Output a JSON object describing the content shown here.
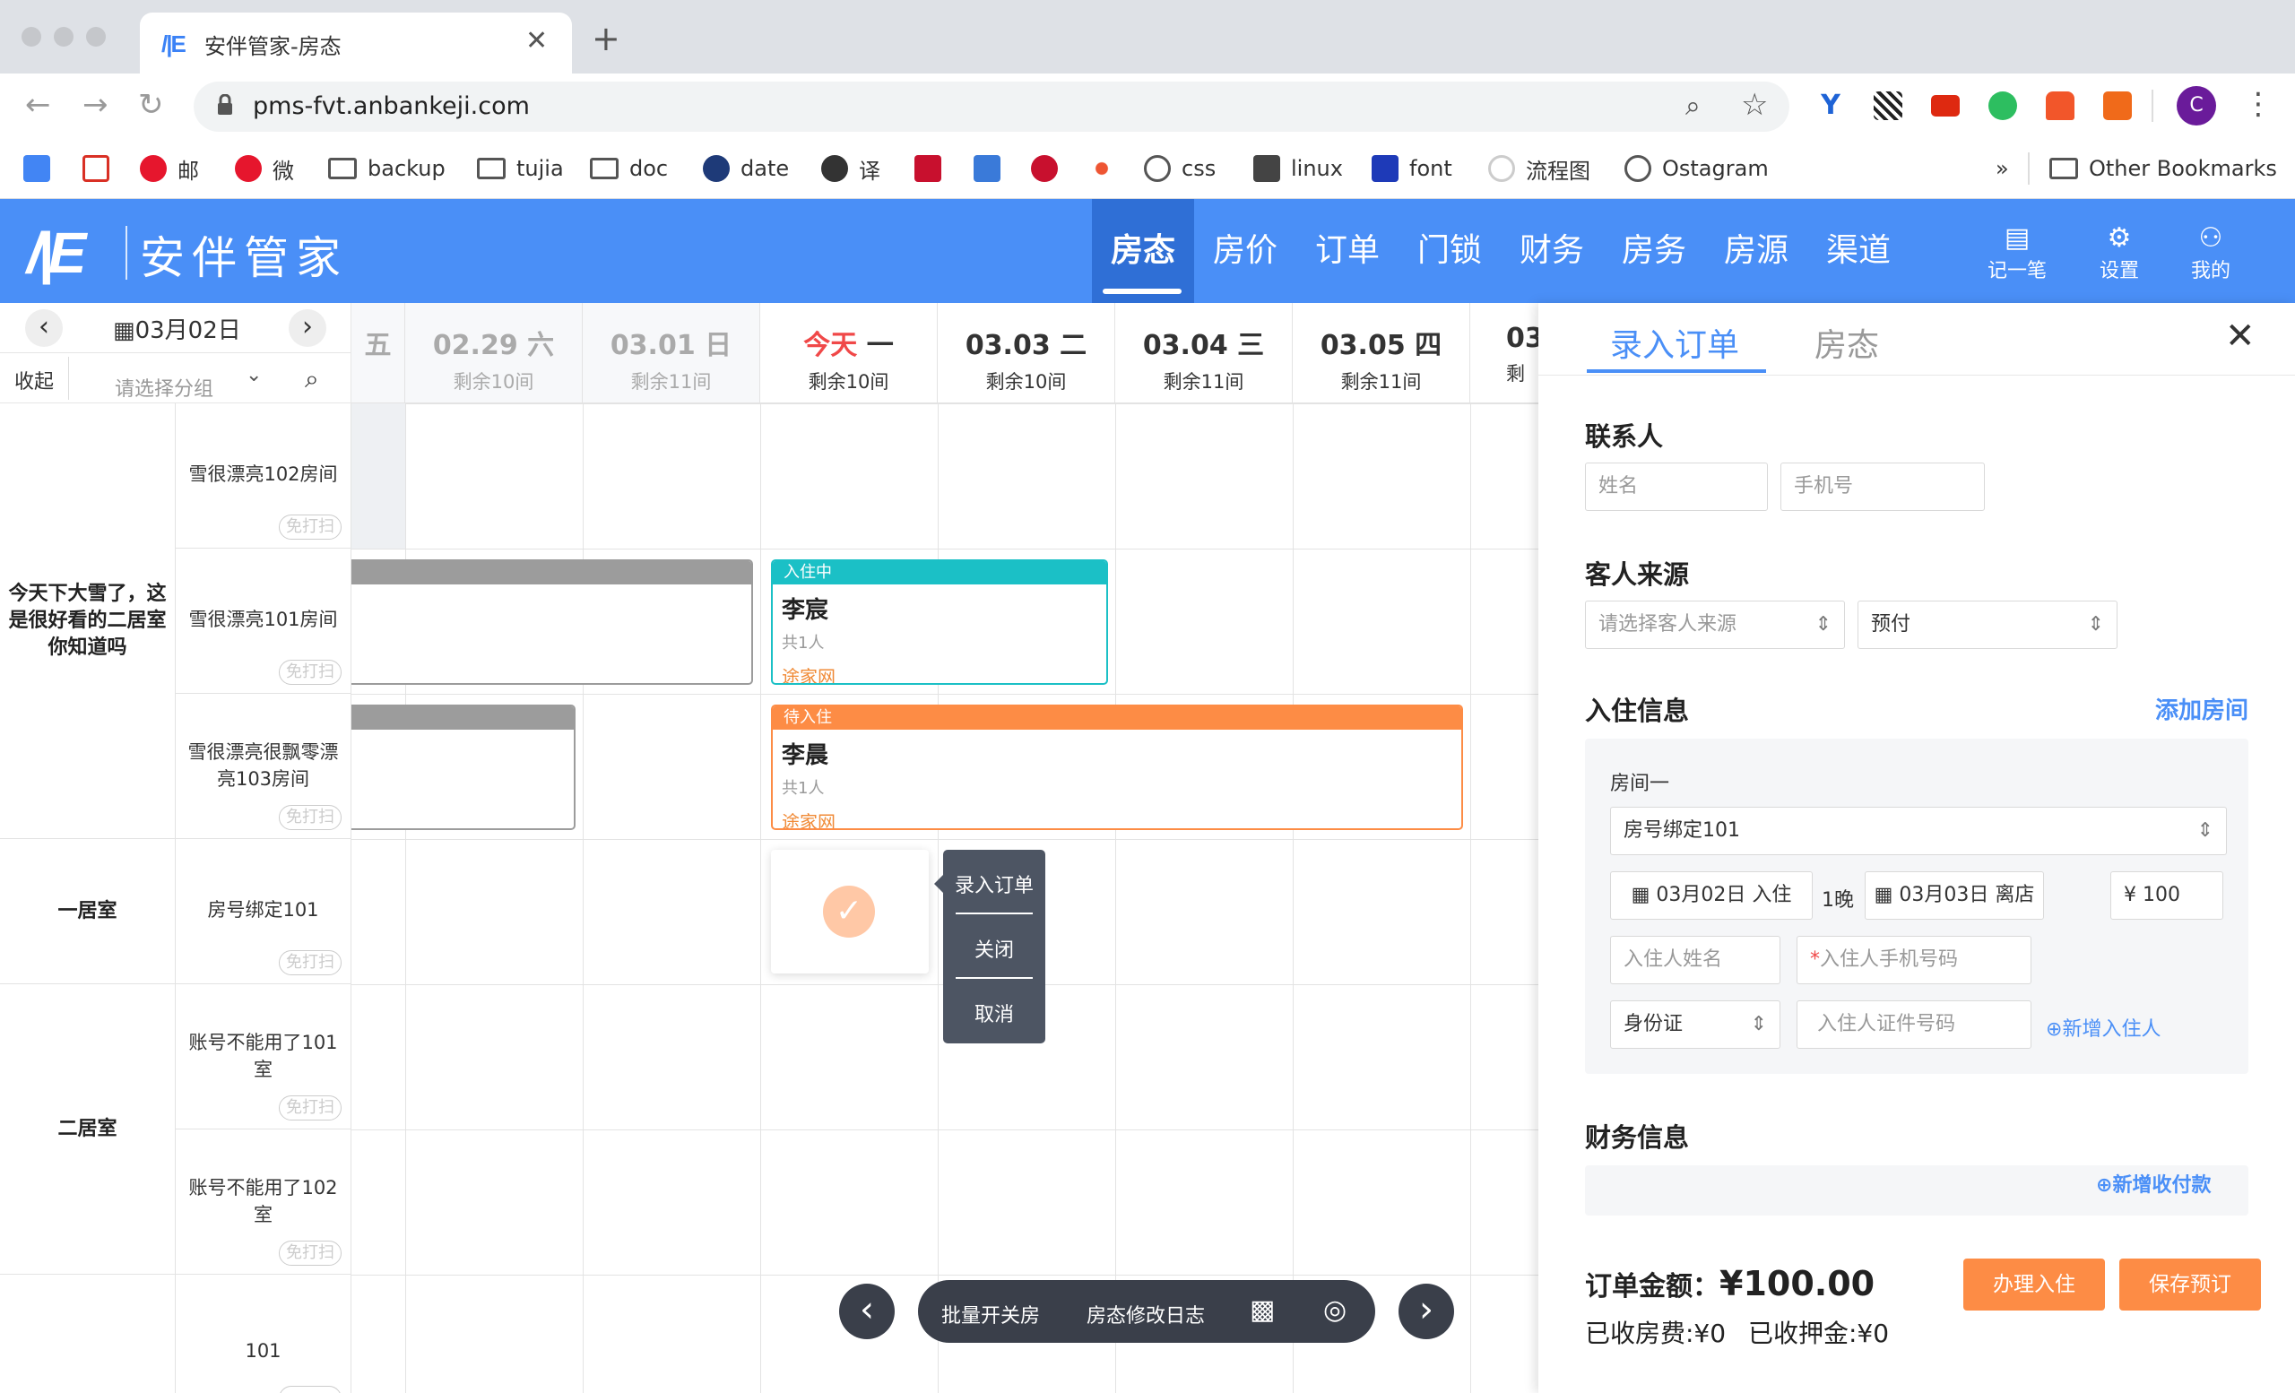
{
  "browser": {
    "tab_title": "安伴管家-房态",
    "tab_logo": "/|E",
    "url": "pms-fvt.anbankeji.com",
    "avatar_letter": "C",
    "bookmarks": [
      "邮",
      "微",
      "backup",
      "tujia",
      "doc",
      "date",
      "译",
      "css",
      "linux",
      "font",
      "流程图",
      "Ostagram",
      "Other Bookmarks"
    ],
    "overflow": "»"
  },
  "header": {
    "logo_mark": "/|E",
    "brand": "安伴管家",
    "nav": [
      "房态",
      "房价",
      "订单",
      "门锁",
      "财务",
      "房务",
      "房源",
      "渠道"
    ],
    "active_nav": "房态",
    "icons": [
      {
        "label": "记一笔",
        "icon": "note-icon"
      },
      {
        "label": "设置",
        "icon": "gear-icon"
      },
      {
        "label": "我的",
        "icon": "user-icon"
      }
    ],
    "color_primary": "#4a8ff7"
  },
  "calendar": {
    "current_date": "03月02日",
    "collapse_label": "收起",
    "group_placeholder": "请选择分组",
    "partial_left_day": "五",
    "days": [
      {
        "date": "02.29",
        "weekday": "六",
        "remain": "剩余10间"
      },
      {
        "date": "03.01",
        "weekday": "日",
        "remain": "剩余11间"
      },
      {
        "date": "今天",
        "weekday": "一",
        "remain": "剩余10间"
      },
      {
        "date": "03.03",
        "weekday": "二",
        "remain": "剩余10间"
      },
      {
        "date": "03.04",
        "weekday": "三",
        "remain": "剩余11间"
      },
      {
        "date": "03.05",
        "weekday": "四",
        "remain": "剩余11间"
      },
      {
        "date": "03",
        "weekday": "",
        "remain": "剩"
      }
    ],
    "room_types": [
      "今天下大雪了，这是很好看的二居室你知道吗",
      "一居室",
      "二居室"
    ],
    "rooms": [
      "雪很漂亮102房间",
      "雪很漂亮101房间",
      "雪很漂亮很飘零漂亮103房间",
      "房号绑定101",
      "账号不能用了101室",
      "账号不能用了102室",
      "101"
    ],
    "scan_badge": "免打扫",
    "bookings": [
      {
        "status": "入住中",
        "guest": "李宸",
        "count": "共1人",
        "channel": "途家网",
        "color": "#1bc0c6"
      },
      {
        "status": "待入住",
        "guest": "李晨",
        "count": "共1人",
        "channel": "途家网",
        "color": "#fd8c45"
      }
    ],
    "context_menu": [
      "录入订单",
      "关闭",
      "取消"
    ],
    "bottom_bar": [
      "批量开关房",
      "房态修改日志"
    ]
  },
  "order_panel": {
    "tabs": [
      "录入订单",
      "房态"
    ],
    "contact_title": "联系人",
    "name_placeholder": "姓名",
    "phone_placeholder": "手机号",
    "source_title": "客人来源",
    "source_placeholder": "请选择客人来源",
    "payment_type": "预付",
    "checkin_title": "入住信息",
    "add_room": "添加房间",
    "room_label": "房间一",
    "room_value": "房号绑定101",
    "checkin_date": "03月02日 入住",
    "nights": "1晚",
    "checkout_date": "03月03日 离店",
    "price": "¥ 100",
    "guest_name_placeholder": "入住人姓名",
    "guest_phone_placeholder": "入住人手机号码",
    "required_mark": "*",
    "id_type": "身份证",
    "id_placeholder": "入住人证件号码",
    "add_guest": "新增入住人",
    "finance_title": "财务信息",
    "add_payment": "新增收付款",
    "total_label": "订单金额：",
    "total_value": "¥100.00",
    "received_fee": "已收房费:¥0",
    "received_deposit": "已收押金:¥0",
    "btn_checkin": "办理入住",
    "btn_save": "保存预订",
    "accent_color": "#fd8c45"
  }
}
